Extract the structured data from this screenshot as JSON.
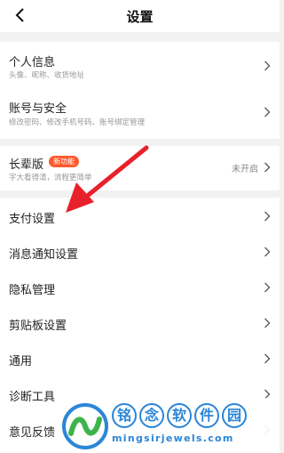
{
  "header": {
    "title": "设置"
  },
  "group1": [
    {
      "title": "个人信息",
      "sub": "头像、昵称、收货地址"
    },
    {
      "title": "账号与安全",
      "sub": "修改密码、修改手机号码、账号绑定管理"
    }
  ],
  "elder": {
    "title": "长辈版",
    "badge": "新功能",
    "sub": "字大看得清，流程更简单",
    "status": "未开启"
  },
  "group3": [
    {
      "title": "支付设置"
    },
    {
      "title": "消息通知设置"
    },
    {
      "title": "隐私管理"
    },
    {
      "title": "剪贴板设置"
    },
    {
      "title": "通用"
    },
    {
      "title": "诊断工具"
    },
    {
      "title": "意见反馈"
    }
  ],
  "watermark": {
    "chars": [
      "铭",
      "念",
      "软",
      "件",
      "园"
    ],
    "url": "mingsirjewels.com"
  },
  "colors": {
    "accent": "#ff5a2c",
    "arrow": "#e8202a",
    "watermark": "#2a86d8"
  }
}
